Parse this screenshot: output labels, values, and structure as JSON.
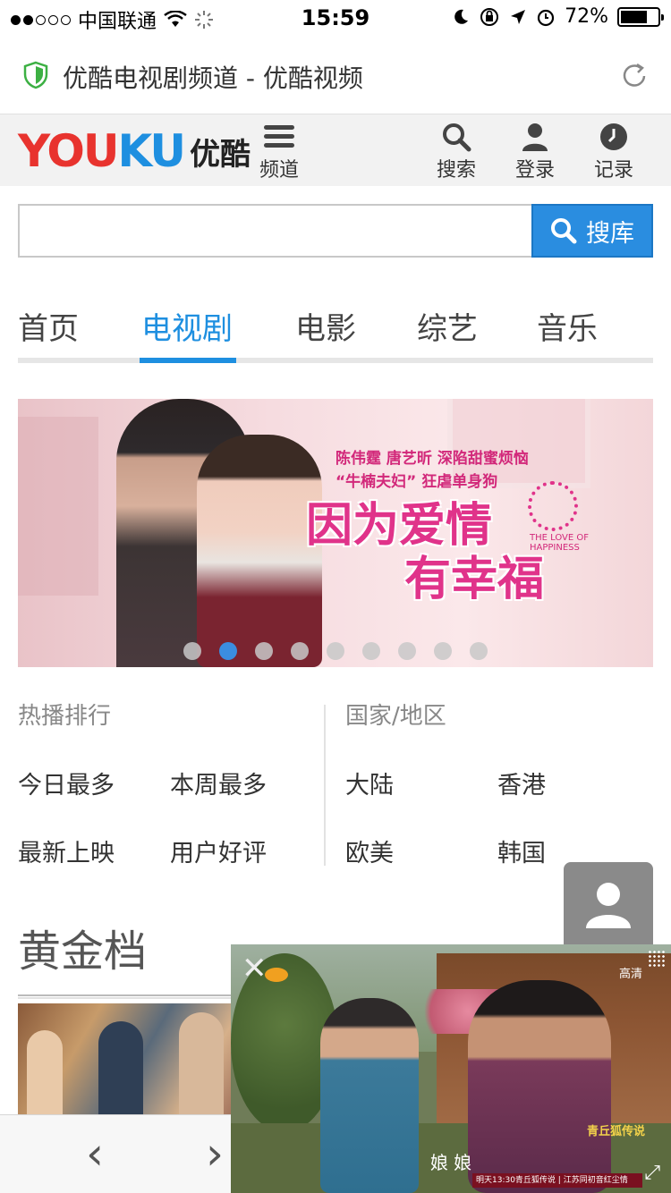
{
  "status_bar": {
    "carrier": "中国联通",
    "time": "15:59",
    "battery": "72%",
    "battery_level": 0.72,
    "signal_strength": 2,
    "signal_max": 5
  },
  "url_bar": {
    "title": "优酷电视剧频道 - 优酷视频",
    "security_icon": "shield-icon",
    "reload_icon": "reload-icon"
  },
  "header": {
    "logo_text_red": "YOU",
    "logo_text_blue": "KU",
    "logo_cn": "优酷",
    "menu_label": "频道",
    "search_label": "搜索",
    "login_label": "登录",
    "history_label": "记录"
  },
  "search": {
    "placeholder": "",
    "button_label": "搜库"
  },
  "tabs": [
    {
      "label": "首页",
      "active": false
    },
    {
      "label": "电视剧",
      "active": true
    },
    {
      "label": "电影",
      "active": false
    },
    {
      "label": "综艺",
      "active": false
    },
    {
      "label": "音乐",
      "active": false
    }
  ],
  "banner": {
    "sub1": "陈伟霆 唐艺昕 深陷甜蜜烦恼",
    "sub2": "“牛楠夫妇” 狂虐单身狗",
    "title_line1": "因为爱情",
    "title_line2": "有幸福",
    "tagline": "THE LOVE OF HAPPINESS",
    "page_count": 9,
    "active_page": 2
  },
  "categories": {
    "ranking_title": "热播排行",
    "ranking_items": [
      "今日最多",
      "本周最多",
      "最新上映",
      "用户好评"
    ],
    "region_title": "国家/地区",
    "region_items": [
      "大陆",
      "香港",
      "欧美",
      "韩国"
    ]
  },
  "section": {
    "title": "黄金档"
  },
  "pip_player": {
    "quality": "高清",
    "subtitle": "娘 娘",
    "ticker": "明天13:30青丘狐传说 | 江苏同初音红尘情",
    "promo": "青丘狐传说"
  },
  "colors": {
    "accent": "#1e8fe0",
    "brand_red": "#e8332e",
    "search_button": "#2a8de0"
  }
}
